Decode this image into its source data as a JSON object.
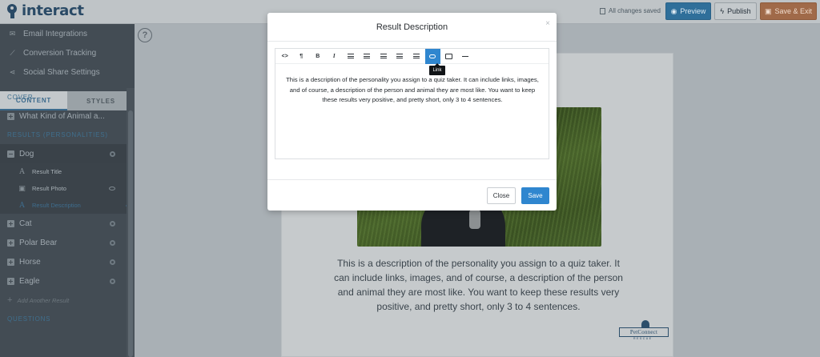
{
  "app": {
    "logo_text": "interact",
    "save_status": "All changes saved",
    "preview_label": "Preview",
    "publish_label": "Publish",
    "save_exit_label": "Save & Exit",
    "accent_color": "#2f86cf"
  },
  "sidebar": {
    "settings": [
      {
        "label": "Email Integrations",
        "icon": "envelope-icon"
      },
      {
        "label": "Conversion Tracking",
        "icon": "chart-line-icon"
      },
      {
        "label": "Social Share Settings",
        "icon": "share-icon"
      }
    ],
    "tabs": [
      "CONTENT",
      "STYLES"
    ],
    "active_tab": "CONTENT",
    "cover_heading": "COVER",
    "cover_item": "What Kind of Animal a...",
    "results_heading": "RESULTS (PERSONALITIES)",
    "results": [
      {
        "label": "Dog",
        "expanded": true
      },
      {
        "label": "Cat"
      },
      {
        "label": "Polar Bear"
      },
      {
        "label": "Horse"
      },
      {
        "label": "Eagle"
      }
    ],
    "dog_subitems": [
      {
        "label": "Result Title",
        "icon": "text-icon"
      },
      {
        "label": "Result Photo",
        "icon": "image-icon"
      },
      {
        "label": "Result Description",
        "icon": "text-icon",
        "active": true
      }
    ],
    "add_result_label": "Add Another Result",
    "questions_heading": "QUESTIONS"
  },
  "canvas": {
    "description": "This is a description of the personality you assign to a quiz taker. It can include links, images, and of course, a description of the person and animal they are most like. You want to keep these results very positive, and pretty short, only 3 to 4 sentences.",
    "logo_text": "PetConnect",
    "logo_subtext": "RESCUE"
  },
  "modal": {
    "title": "Result Description",
    "close_glyph": "×",
    "toolbar": [
      {
        "name": "code-view",
        "glyph": "<>"
      },
      {
        "name": "paragraph",
        "glyph": "¶"
      },
      {
        "name": "bold",
        "glyph": "B"
      },
      {
        "name": "italic",
        "glyph": "I"
      },
      {
        "name": "unordered-list",
        "glyph": "☰"
      },
      {
        "name": "ordered-list",
        "glyph": "☰"
      },
      {
        "name": "outdent",
        "glyph": "☰"
      },
      {
        "name": "indent",
        "glyph": "☰"
      },
      {
        "name": "align",
        "glyph": "☰"
      },
      {
        "name": "link",
        "glyph": "link",
        "active": true
      },
      {
        "name": "image",
        "glyph": "img"
      },
      {
        "name": "horizontal-rule",
        "glyph": "—"
      }
    ],
    "tooltip": "Link",
    "content": "This is a description of the personality you assign to a quiz taker. It can include links, images, and of course, a description of the person and animal they are most like. You want to keep these results very positive, and pretty short, only 3 to 4 sentences.",
    "close_label": "Close",
    "save_label": "Save"
  }
}
